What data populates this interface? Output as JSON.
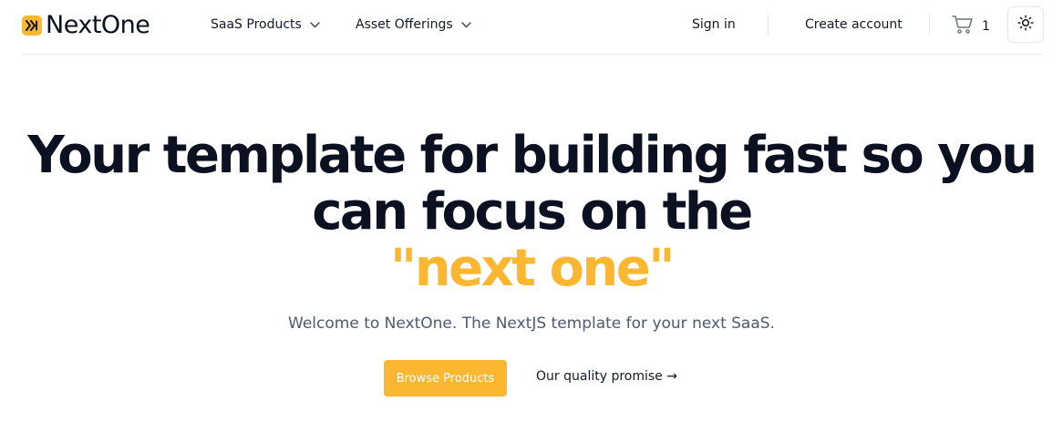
{
  "brand": {
    "name": "NextOne",
    "accent_color": "#fbb731",
    "logo_icon": "fast-forward-icon"
  },
  "nav": {
    "menus": [
      {
        "label": "SaaS Products",
        "icon": "chevron-down-icon"
      },
      {
        "label": "Asset Offerings",
        "icon": "chevron-down-icon"
      }
    ],
    "sign_in": "Sign in",
    "create_account": "Create account",
    "cart": {
      "icon": "cart-icon",
      "count": "1"
    },
    "theme_toggle_icon": "sun-icon"
  },
  "hero": {
    "title": "Your template for building fast so you can focus on the",
    "title_accent": "\"next one\"",
    "subtitle": "Welcome to NextOne. The NextJS template for your next SaaS.",
    "primary_cta": "Browse Products",
    "secondary_cta": "Our quality promise →"
  },
  "colors": {
    "text_dark": "#0b1120",
    "subtitle": "#4b5a72",
    "border": "#e5e7eb"
  }
}
